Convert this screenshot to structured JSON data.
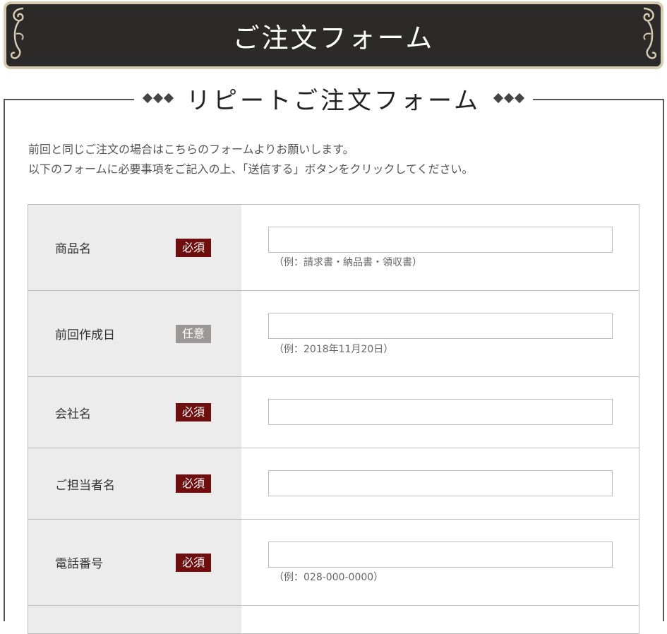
{
  "banner": {
    "title": "ご注文フォーム"
  },
  "section": {
    "heading": "リピートご注文フォーム"
  },
  "intro": {
    "line1": "前回と同じご注文の場合はこちらのフォームよりお願いします。",
    "line2": "以下のフォームに必要事項をご記入の上、「送信する」ボタンをクリックしてください。"
  },
  "form": {
    "rows": [
      {
        "label": "商品名",
        "badge": "必須",
        "hint": "（例：請求書・納品書・領収書）"
      },
      {
        "label": "前回作成日",
        "badge": "任意",
        "hint": "（例：2018年11月20日）"
      },
      {
        "label": "会社名",
        "badge": "必須"
      },
      {
        "label": "ご担当者名",
        "badge": "必須"
      },
      {
        "label": "電話番号",
        "badge": "必須",
        "hint": "（例：028-000-0000）"
      }
    ]
  },
  "colors": {
    "banner_bg": "#2b2a29",
    "banner_border": "#d8cbb4",
    "required_badge": "#6e0e0e",
    "optional_badge": "#9a9796",
    "label_cell_bg": "#ececec"
  }
}
